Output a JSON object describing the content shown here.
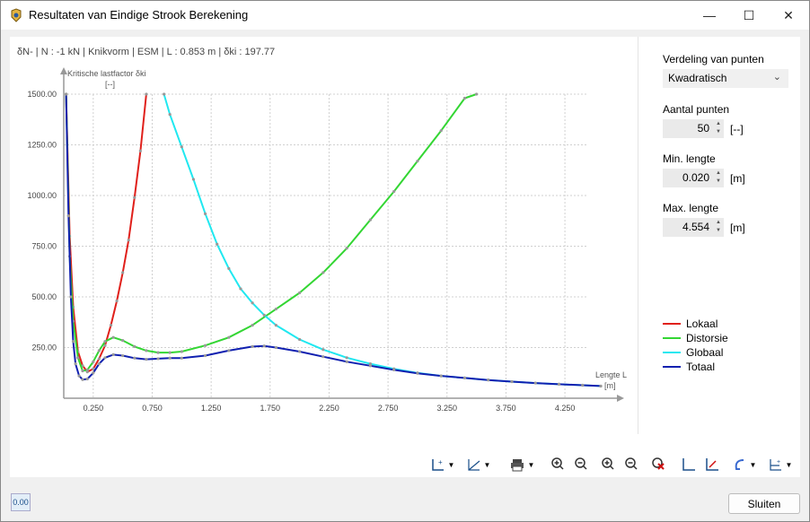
{
  "window": {
    "title": "Resultaten van Eindige Strook Berekening",
    "minimize_glyph": "—",
    "maximize_glyph": "☐",
    "close_glyph": "✕"
  },
  "chart_header": {
    "info": "δN- | N : -1 kN | Knikvorm | ESM | L : 0.853 m | δki : 197.77"
  },
  "chart_data": {
    "type": "line",
    "ylabel": "Kritische lastfactor δki",
    "yunit": "[--]",
    "xlabel": "Lengte L",
    "xunit": "[m]",
    "xlim": [
      0,
      4.554
    ],
    "ylim": [
      0,
      1500
    ],
    "x_ticks": [
      "0.250",
      "0.750",
      "1.250",
      "1.750",
      "2.250",
      "2.750",
      "3.250",
      "3.750",
      "4.250"
    ],
    "y_ticks": [
      "250.00",
      "500.00",
      "750.00",
      "1000.00",
      "1250.00",
      "1500.00"
    ],
    "grid": true,
    "legend_position": "right",
    "series": [
      {
        "name": "Lokaal",
        "color": "#e0201b",
        "points": [
          [
            0.02,
            1500
          ],
          [
            0.05,
            800
          ],
          [
            0.08,
            450
          ],
          [
            0.12,
            230
          ],
          [
            0.16,
            160
          ],
          [
            0.2,
            130
          ],
          [
            0.25,
            145
          ],
          [
            0.3,
            195
          ],
          [
            0.35,
            260
          ],
          [
            0.4,
            360
          ],
          [
            0.45,
            480
          ],
          [
            0.5,
            620
          ],
          [
            0.55,
            780
          ],
          [
            0.6,
            990
          ],
          [
            0.65,
            1220
          ],
          [
            0.7,
            1500
          ]
        ]
      },
      {
        "name": "Distorsie",
        "color": "#33d633",
        "points": [
          [
            0.02,
            1500
          ],
          [
            0.05,
            700
          ],
          [
            0.08,
            380
          ],
          [
            0.12,
            200
          ],
          [
            0.16,
            135
          ],
          [
            0.2,
            140
          ],
          [
            0.25,
            180
          ],
          [
            0.3,
            235
          ],
          [
            0.35,
            280
          ],
          [
            0.42,
            300
          ],
          [
            0.5,
            285
          ],
          [
            0.6,
            255
          ],
          [
            0.7,
            235
          ],
          [
            0.8,
            225
          ],
          [
            0.9,
            225
          ],
          [
            1.0,
            230
          ],
          [
            1.2,
            260
          ],
          [
            1.4,
            300
          ],
          [
            1.6,
            360
          ],
          [
            1.8,
            440
          ],
          [
            2.0,
            520
          ],
          [
            2.2,
            620
          ],
          [
            2.4,
            740
          ],
          [
            2.6,
            880
          ],
          [
            2.8,
            1020
          ],
          [
            3.0,
            1170
          ],
          [
            3.2,
            1320
          ],
          [
            3.4,
            1480
          ],
          [
            3.5,
            1500
          ]
        ]
      },
      {
        "name": "Globaal",
        "color": "#20e8f0",
        "points": [
          [
            0.85,
            1500
          ],
          [
            0.9,
            1400
          ],
          [
            1.0,
            1240
          ],
          [
            1.1,
            1080
          ],
          [
            1.2,
            910
          ],
          [
            1.3,
            760
          ],
          [
            1.4,
            640
          ],
          [
            1.5,
            540
          ],
          [
            1.6,
            470
          ],
          [
            1.7,
            410
          ],
          [
            1.8,
            360
          ],
          [
            2.0,
            290
          ],
          [
            2.2,
            240
          ],
          [
            2.4,
            200
          ],
          [
            2.6,
            170
          ],
          [
            2.8,
            145
          ],
          [
            3.0,
            125
          ],
          [
            3.2,
            110
          ],
          [
            3.4,
            100
          ],
          [
            3.6,
            90
          ],
          [
            3.8,
            82
          ],
          [
            4.0,
            75
          ],
          [
            4.2,
            69
          ],
          [
            4.4,
            64
          ],
          [
            4.554,
            60
          ]
        ]
      },
      {
        "name": "Totaal",
        "color": "#1020b0",
        "points": [
          [
            0.02,
            1500
          ],
          [
            0.04,
            900
          ],
          [
            0.06,
            500
          ],
          [
            0.08,
            280
          ],
          [
            0.1,
            170
          ],
          [
            0.13,
            110
          ],
          [
            0.16,
            92
          ],
          [
            0.2,
            95
          ],
          [
            0.25,
            125
          ],
          [
            0.3,
            170
          ],
          [
            0.35,
            200
          ],
          [
            0.42,
            215
          ],
          [
            0.5,
            210
          ],
          [
            0.6,
            198
          ],
          [
            0.7,
            192
          ],
          [
            0.8,
            195
          ],
          [
            0.9,
            198
          ],
          [
            1.0,
            198
          ],
          [
            1.2,
            210
          ],
          [
            1.4,
            235
          ],
          [
            1.6,
            255
          ],
          [
            1.7,
            258
          ],
          [
            1.8,
            250
          ],
          [
            2.0,
            230
          ],
          [
            2.2,
            205
          ],
          [
            2.4,
            180
          ],
          [
            2.6,
            160
          ],
          [
            2.8,
            140
          ],
          [
            3.0,
            123
          ],
          [
            3.2,
            110
          ],
          [
            3.4,
            100
          ],
          [
            3.6,
            90
          ],
          [
            3.8,
            82
          ],
          [
            4.0,
            75
          ],
          [
            4.2,
            69
          ],
          [
            4.4,
            64
          ],
          [
            4.554,
            60
          ]
        ]
      }
    ]
  },
  "panel": {
    "verdeling_label": "Verdeling van punten",
    "verdeling_value": "Kwadratisch",
    "aantal_label": "Aantal punten",
    "aantal_value": "50",
    "aantal_unit": "[--]",
    "min_label": "Min. lengte",
    "min_value": "0.020",
    "min_unit": "[m]",
    "max_label": "Max. lengte",
    "max_value": "4.554",
    "max_unit": "[m]"
  },
  "legend": [
    {
      "label": "Lokaal",
      "color": "#e0201b"
    },
    {
      "label": "Distorsie",
      "color": "#33d633"
    },
    {
      "label": "Globaal",
      "color": "#20e8f0"
    },
    {
      "label": "Totaal",
      "color": "#1020b0"
    }
  ],
  "footer": {
    "close_label": "Sluiten",
    "value_icon_text": "0.00"
  }
}
